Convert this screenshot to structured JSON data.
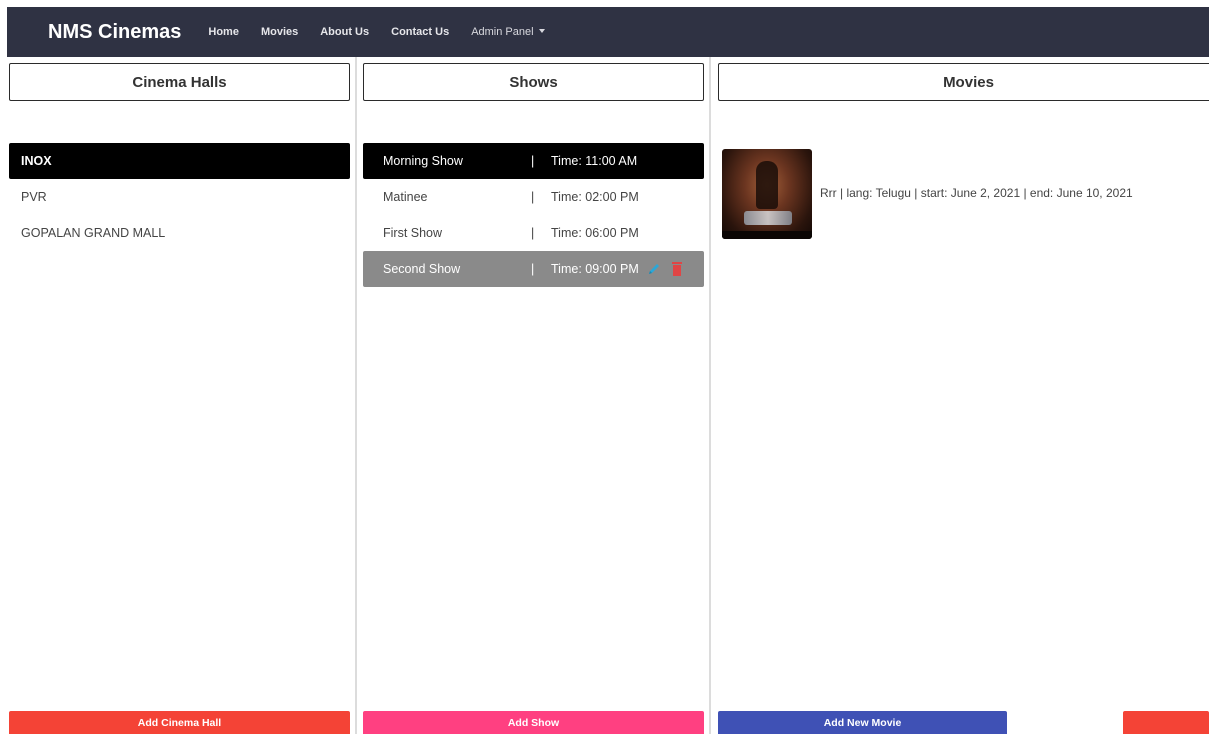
{
  "navbar": {
    "brand": "NMS Cinemas",
    "links": [
      "Home",
      "Movies",
      "About Us",
      "Contact Us"
    ],
    "admin_label": "Admin Panel"
  },
  "columns": {
    "halls_title": "Cinema Halls",
    "shows_title": "Shows",
    "movies_title": "Movies"
  },
  "halls": [
    {
      "name": "INOX",
      "state": "selected"
    },
    {
      "name": "PVR"
    },
    {
      "name": "GOPALAN GRAND MALL"
    }
  ],
  "shows": [
    {
      "name": "Morning Show",
      "sep": "|",
      "time": "Time: 11:00 AM",
      "state": "selected"
    },
    {
      "name": "Matinee",
      "sep": "|",
      "time": "Time: 02:00 PM"
    },
    {
      "name": "First Show",
      "sep": "|",
      "time": "Time: 06:00 PM"
    },
    {
      "name": "Second Show",
      "sep": "|",
      "time": "Time: 09:00 PM",
      "state": "hovered"
    }
  ],
  "movies": [
    {
      "text": "Rrr | lang: Telugu | start: June 2, 2021 | end: June 10, 2021",
      "poster": "movie-poster"
    }
  ],
  "icons": {
    "edit": "pencil-icon",
    "delete": "trash-icon",
    "dropdown": "caret-down-icon"
  },
  "buttons": {
    "add_hall": "Add Cinema Hall",
    "add_show": "Add Show",
    "add_movie": "Add New Movie"
  },
  "colors": {
    "navbar": "#2f3243",
    "add_hall": "#f44336",
    "add_show": "#ff4081",
    "add_movie": "#3f51b5",
    "edit_icon": "#2aa7d8",
    "delete_icon": "#e04545",
    "hover_row": "#8a8a8a"
  }
}
